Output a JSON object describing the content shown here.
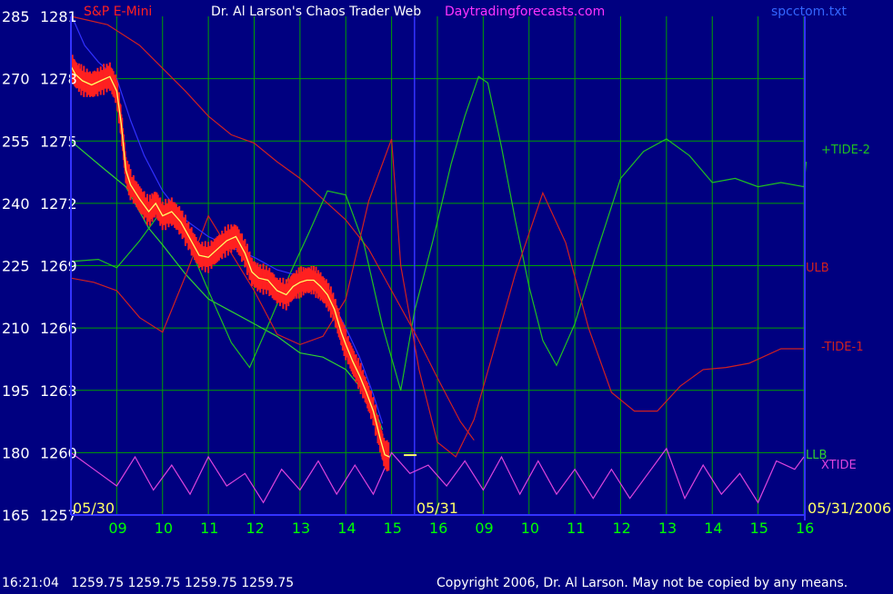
{
  "colors": {
    "background": "#000080",
    "grid": "#00a000",
    "axis": "#3333ff",
    "price": "#ff2020",
    "price_avg": "#ffff66",
    "blue_line": "#3030ff",
    "ulb": "#d02020",
    "llb": "#30d030",
    "plus_tide": "#20c020",
    "minus_tide": "#d02020",
    "xtide": "#dd44dd",
    "header_title": "#ffffff",
    "header_site": "#ff33ff",
    "header_symbol": "#ff2020",
    "header_file": "#3366ff"
  },
  "header": {
    "symbol": "S&P E-Mini",
    "title": "Dr. Al Larson's Chaos Trader Web",
    "site": "Daytradingforecasts.com",
    "file": "spcctom.txt"
  },
  "footer": {
    "status": "16:21:04   1259.75 1259.75 1259.75 1259.75",
    "copyright": "Copyright 2006, Dr. Al Larson. May not be copied by any means."
  },
  "chart_data": {
    "type": "line",
    "left_axis_ticks": [
      "285",
      "270",
      "255",
      "240",
      "225",
      "210",
      "195",
      "180",
      "165"
    ],
    "price_axis_ticks": [
      "1281",
      "1278",
      "1275",
      "1272",
      "1269",
      "1266",
      "1263",
      "1260",
      "1257"
    ],
    "price_ylim": [
      1257,
      1281
    ],
    "index_ylim": [
      165,
      285
    ],
    "x_ticks": [
      "09",
      "10",
      "11",
      "12",
      "13",
      "14",
      "15",
      "16",
      "09",
      "10",
      "11",
      "12",
      "13",
      "14",
      "15",
      "16"
    ],
    "date_labels": [
      "05/30",
      "05/31",
      "05/31/2006"
    ],
    "series_labels": [
      "+TIDE-2",
      "ULB",
      "-TIDE-1",
      "LLB",
      "XTIDE"
    ],
    "x_range_hours": [
      0,
      16
    ],
    "session_split_hour": 8,
    "price_path": [
      [
        0,
        1278.6
      ],
      [
        0.1,
        1278.2
      ],
      [
        0.25,
        1277.9
      ],
      [
        0.45,
        1277.7
      ],
      [
        0.65,
        1277.9
      ],
      [
        0.85,
        1278.1
      ],
      [
        1.0,
        1277.4
      ],
      [
        1.1,
        1275.8
      ],
      [
        1.2,
        1273.6
      ],
      [
        1.3,
        1272.9
      ],
      [
        1.5,
        1272.2
      ],
      [
        1.7,
        1271.6
      ],
      [
        1.85,
        1272.0
      ],
      [
        2.0,
        1271.4
      ],
      [
        2.2,
        1271.6
      ],
      [
        2.4,
        1271.1
      ],
      [
        2.6,
        1270.3
      ],
      [
        2.8,
        1269.5
      ],
      [
        3.0,
        1269.4
      ],
      [
        3.2,
        1269.8
      ],
      [
        3.4,
        1270.2
      ],
      [
        3.6,
        1270.4
      ],
      [
        3.8,
        1269.6
      ],
      [
        3.95,
        1268.7
      ],
      [
        4.1,
        1268.4
      ],
      [
        4.3,
        1268.3
      ],
      [
        4.5,
        1267.8
      ],
      [
        4.7,
        1267.6
      ],
      [
        4.85,
        1268.0
      ],
      [
        5.0,
        1268.2
      ],
      [
        5.15,
        1268.3
      ],
      [
        5.3,
        1268.3
      ],
      [
        5.45,
        1268.0
      ],
      [
        5.6,
        1267.6
      ],
      [
        5.75,
        1266.9
      ],
      [
        5.9,
        1265.8
      ],
      [
        6.0,
        1265.2
      ],
      [
        6.15,
        1264.4
      ],
      [
        6.3,
        1263.7
      ],
      [
        6.45,
        1262.9
      ],
      [
        6.6,
        1262.0
      ],
      [
        6.75,
        1260.7
      ],
      [
        6.85,
        1259.9
      ],
      [
        6.95,
        1259.8
      ]
    ],
    "price_low_anchor": 1259.75,
    "blue_line": [
      [
        0,
        1281.1
      ],
      [
        0.3,
        1279.6
      ],
      [
        0.6,
        1278.8
      ],
      [
        1.0,
        1278.0
      ],
      [
        1.3,
        1276.0
      ],
      [
        1.6,
        1274.3
      ],
      [
        2.0,
        1272.6
      ],
      [
        2.5,
        1271.2
      ],
      [
        3.0,
        1270.4
      ],
      [
        3.5,
        1269.9
      ],
      [
        4.0,
        1269.4
      ],
      [
        4.5,
        1268.8
      ],
      [
        5.0,
        1268.5
      ],
      [
        5.4,
        1268.3
      ],
      [
        5.7,
        1267.3
      ],
      [
        6.0,
        1266.0
      ],
      [
        6.3,
        1264.6
      ],
      [
        6.6,
        1262.8
      ],
      [
        6.8,
        1261.4
      ]
    ],
    "ulb": [
      [
        0,
        1281.0
      ],
      [
        0.8,
        1280.6
      ],
      [
        1.5,
        1279.6
      ],
      [
        2.0,
        1278.5
      ],
      [
        2.5,
        1277.4
      ],
      [
        3.0,
        1276.2
      ],
      [
        3.5,
        1275.3
      ],
      [
        4.0,
        1274.9
      ],
      [
        4.5,
        1274.0
      ],
      [
        5.0,
        1273.2
      ],
      [
        5.5,
        1272.2
      ],
      [
        6.0,
        1271.2
      ],
      [
        6.5,
        1269.8
      ],
      [
        7.0,
        1267.8
      ],
      [
        7.5,
        1265.8
      ],
      [
        8.0,
        1263.6
      ],
      [
        8.5,
        1261.5
      ],
      [
        8.8,
        1260.6
      ]
    ],
    "llb": [
      [
        0,
        1275.0
      ],
      [
        0.7,
        1273.7
      ],
      [
        1.2,
        1272.8
      ],
      [
        1.7,
        1270.8
      ],
      [
        2.0,
        1270.0
      ],
      [
        2.5,
        1268.6
      ],
      [
        3.0,
        1267.4
      ],
      [
        3.5,
        1266.8
      ],
      [
        4.0,
        1266.2
      ],
      [
        4.5,
        1265.6
      ],
      [
        5.0,
        1264.8
      ],
      [
        5.5,
        1264.6
      ],
      [
        6.0,
        1264.0
      ],
      [
        6.3,
        1263.2
      ],
      [
        6.6,
        1262.3
      ],
      [
        6.8,
        1261.1
      ]
    ],
    "plus_tide_2": [
      [
        0,
        1269.2
      ],
      [
        0.6,
        1269.3
      ],
      [
        1.0,
        1268.9
      ],
      [
        1.5,
        1270.2
      ],
      [
        2.0,
        1271.7
      ],
      [
        2.5,
        1270.4
      ],
      [
        3.0,
        1267.8
      ],
      [
        3.5,
        1265.3
      ],
      [
        3.9,
        1264.1
      ],
      [
        4.3,
        1266.1
      ],
      [
        4.8,
        1268.7
      ],
      [
        5.2,
        1270.6
      ],
      [
        5.6,
        1272.6
      ],
      [
        6.0,
        1272.4
      ],
      [
        6.4,
        1270.0
      ],
      [
        6.8,
        1266.1
      ],
      [
        7.2,
        1263.0
      ],
      [
        7.5,
        1266.8
      ],
      [
        7.9,
        1270.2
      ],
      [
        8.3,
        1273.9
      ],
      [
        8.6,
        1276.2
      ],
      [
        8.9,
        1278.1
      ],
      [
        9.1,
        1277.8
      ],
      [
        9.4,
        1274.7
      ],
      [
        9.7,
        1271.2
      ],
      [
        10.0,
        1268.0
      ],
      [
        10.3,
        1265.4
      ],
      [
        10.6,
        1264.2
      ],
      [
        11.0,
        1266.2
      ],
      [
        11.5,
        1269.8
      ],
      [
        12.0,
        1273.2
      ],
      [
        12.5,
        1274.5
      ],
      [
        13.0,
        1275.1
      ],
      [
        13.5,
        1274.3
      ],
      [
        14.0,
        1273.0
      ],
      [
        14.5,
        1273.2
      ],
      [
        15.0,
        1272.8
      ],
      [
        15.5,
        1273.0
      ],
      [
        16.0,
        1272.8
      ],
      [
        16.05,
        1274.0
      ]
    ],
    "minus_tide_1": [
      [
        0,
        1268.4
      ],
      [
        0.5,
        1268.2
      ],
      [
        1.0,
        1267.8
      ],
      [
        1.5,
        1266.5
      ],
      [
        2.0,
        1265.8
      ],
      [
        2.5,
        1268.5
      ],
      [
        3.0,
        1271.4
      ],
      [
        3.5,
        1269.6
      ],
      [
        4.0,
        1267.8
      ],
      [
        4.5,
        1265.7
      ],
      [
        5.0,
        1265.2
      ],
      [
        5.5,
        1265.6
      ],
      [
        6.0,
        1267.4
      ],
      [
        6.5,
        1272.1
      ],
      [
        7.0,
        1275.1
      ],
      [
        7.2,
        1269.0
      ],
      [
        7.6,
        1264.0
      ],
      [
        8.0,
        1260.5
      ],
      [
        8.4,
        1259.8
      ],
      [
        8.8,
        1261.6
      ],
      [
        9.2,
        1264.7
      ],
      [
        9.7,
        1268.6
      ],
      [
        10.3,
        1272.5
      ],
      [
        10.8,
        1270.1
      ],
      [
        11.3,
        1266.0
      ],
      [
        11.8,
        1262.9
      ],
      [
        12.3,
        1262.0
      ],
      [
        12.8,
        1262.0
      ],
      [
        13.3,
        1263.2
      ],
      [
        13.8,
        1264.0
      ],
      [
        14.3,
        1264.1
      ],
      [
        14.8,
        1264.3
      ],
      [
        15.5,
        1265.0
      ],
      [
        16.0,
        1265.0
      ]
    ],
    "xtide": [
      [
        0,
        1260.0
      ],
      [
        0.5,
        1259.2
      ],
      [
        1.0,
        1258.4
      ],
      [
        1.4,
        1259.8
      ],
      [
        1.8,
        1258.2
      ],
      [
        2.2,
        1259.4
      ],
      [
        2.6,
        1258.0
      ],
      [
        3.0,
        1259.8
      ],
      [
        3.4,
        1258.4
      ],
      [
        3.8,
        1259.0
      ],
      [
        4.2,
        1257.6
      ],
      [
        4.6,
        1259.2
      ],
      [
        5.0,
        1258.2
      ],
      [
        5.4,
        1259.6
      ],
      [
        5.8,
        1258.0
      ],
      [
        6.2,
        1259.4
      ],
      [
        6.6,
        1258.0
      ],
      [
        7.0,
        1260.0
      ],
      [
        7.4,
        1259.0
      ],
      [
        7.8,
        1259.4
      ],
      [
        8.2,
        1258.4
      ],
      [
        8.6,
        1259.6
      ],
      [
        9.0,
        1258.2
      ],
      [
        9.4,
        1259.8
      ],
      [
        9.8,
        1258.0
      ],
      [
        10.2,
        1259.6
      ],
      [
        10.6,
        1258.0
      ],
      [
        11.0,
        1259.2
      ],
      [
        11.4,
        1257.8
      ],
      [
        11.8,
        1259.2
      ],
      [
        12.2,
        1257.8
      ],
      [
        12.6,
        1259.0
      ],
      [
        13.0,
        1260.2
      ],
      [
        13.4,
        1257.8
      ],
      [
        13.8,
        1259.4
      ],
      [
        14.2,
        1258.0
      ],
      [
        14.6,
        1259.0
      ],
      [
        15.0,
        1257.6
      ],
      [
        15.4,
        1259.6
      ],
      [
        15.8,
        1259.2
      ],
      [
        16.0,
        1259.8
      ]
    ]
  }
}
